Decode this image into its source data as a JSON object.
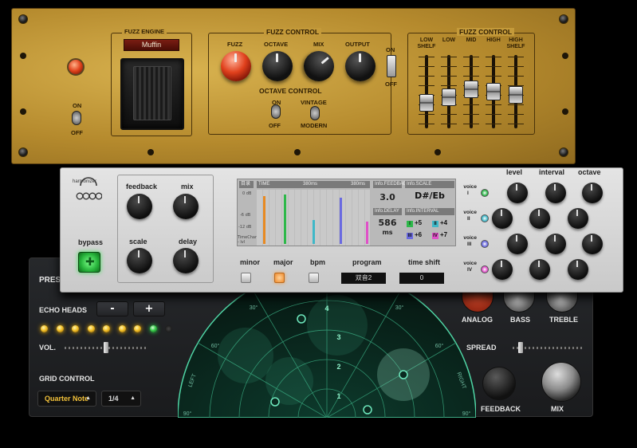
{
  "echo": {
    "preset_label": "PRESET",
    "echo_heads_label": "ECHO HEADS",
    "minus_label": "-",
    "plus_label": "+",
    "vol_label": "VOL.",
    "grid_control_label": "GRID CONTROL",
    "grid_note_value": "Quarter Note",
    "grid_division_value": "1/4",
    "analog_label": "ANALOG",
    "bass_label": "BASS",
    "treble_label": "TREBLE",
    "spread_label": "SPREAD",
    "feedback_label": "FEEDBACK",
    "mix_label": "MIX",
    "radar": {
      "ring_labels": [
        "1",
        "2",
        "3",
        "4"
      ],
      "angle_labels": [
        "60°",
        "30°",
        "30°",
        "60°",
        "90°",
        "90°"
      ],
      "side_left": "LEFT",
      "side_right": "RIGHT"
    },
    "head_leds": [
      "on",
      "on",
      "on",
      "on",
      "on",
      "on",
      "on",
      "green",
      "off"
    ],
    "vol_level": 0.5,
    "spread_level": 0.08
  },
  "fuzz": {
    "engine_title": "FUZZ ENGINE",
    "engine_value": "Muffin",
    "power_on_label": "ON",
    "power_off_label": "OFF",
    "control_title": "FUZZ CONTROL",
    "knob_fuzz": "FUZZ",
    "knob_octave": "OCTAVE",
    "knob_mix": "MIX",
    "knob_output": "OUTPUT",
    "octave_control_title": "OCTAVE CONTROL",
    "oct_on": "ON",
    "oct_off": "OFF",
    "vintage": "VINTAGE",
    "modern": "MODERN",
    "out_on": "ON",
    "out_off": "OFF",
    "eq_title": "FUZZ CONTROL",
    "eq_bands": [
      "LOW SHELF",
      "LOW",
      "MID",
      "HIGH",
      "HIGH SHELF"
    ],
    "eq_levels": [
      0.3,
      0.4,
      0.55,
      0.5,
      0.45
    ]
  },
  "harm": {
    "brand": "harmonizer",
    "feedback": "feedback",
    "mix": "mix",
    "scale": "scale",
    "delay": "delay",
    "bypass": "bypass",
    "minor": "minor",
    "major": "major",
    "bpm": "bpm",
    "program": "program",
    "program_value": "双音2",
    "time_shift": "time shift",
    "time_shift_value": "0",
    "level": "level",
    "interval": "interval",
    "octave": "octave",
    "voices": [
      {
        "label": "voice",
        "num": "I",
        "color": "#2eb84a"
      },
      {
        "label": "voice",
        "num": "II",
        "color": "#3fb8c8"
      },
      {
        "label": "voice",
        "num": "III",
        "color": "#6a6ae0"
      },
      {
        "label": "voice",
        "num": "IV",
        "color": "#e050c8"
      }
    ],
    "screen": {
      "mini_label": "目录",
      "time_label": "TIME",
      "time_mid": "380ms",
      "time_right": "380ms",
      "db_labels": [
        "0 dB",
        "-6 dB",
        "-12 dB"
      ],
      "chart_foot": "TimeChart - lvl",
      "feedback_label": "Info.FEEDBACK",
      "feedback_value": "3.0",
      "delay_label": "Info.DELAY",
      "delay_value": "586",
      "delay_unit": "ms",
      "scale_label": "Info.SCALE",
      "scale_value": "D#/Eb",
      "interval_label": "Info.INTERVAL",
      "intervals": [
        {
          "tag": "I",
          "value": "+5",
          "color": "#2eb84a"
        },
        {
          "tag": "II",
          "value": "+4",
          "color": "#3fb8c8"
        },
        {
          "tag": "III",
          "value": "+6",
          "color": "#6a6ae0"
        },
        {
          "tag": "IV",
          "value": "+7",
          "color": "#e050c8"
        }
      ]
    }
  }
}
